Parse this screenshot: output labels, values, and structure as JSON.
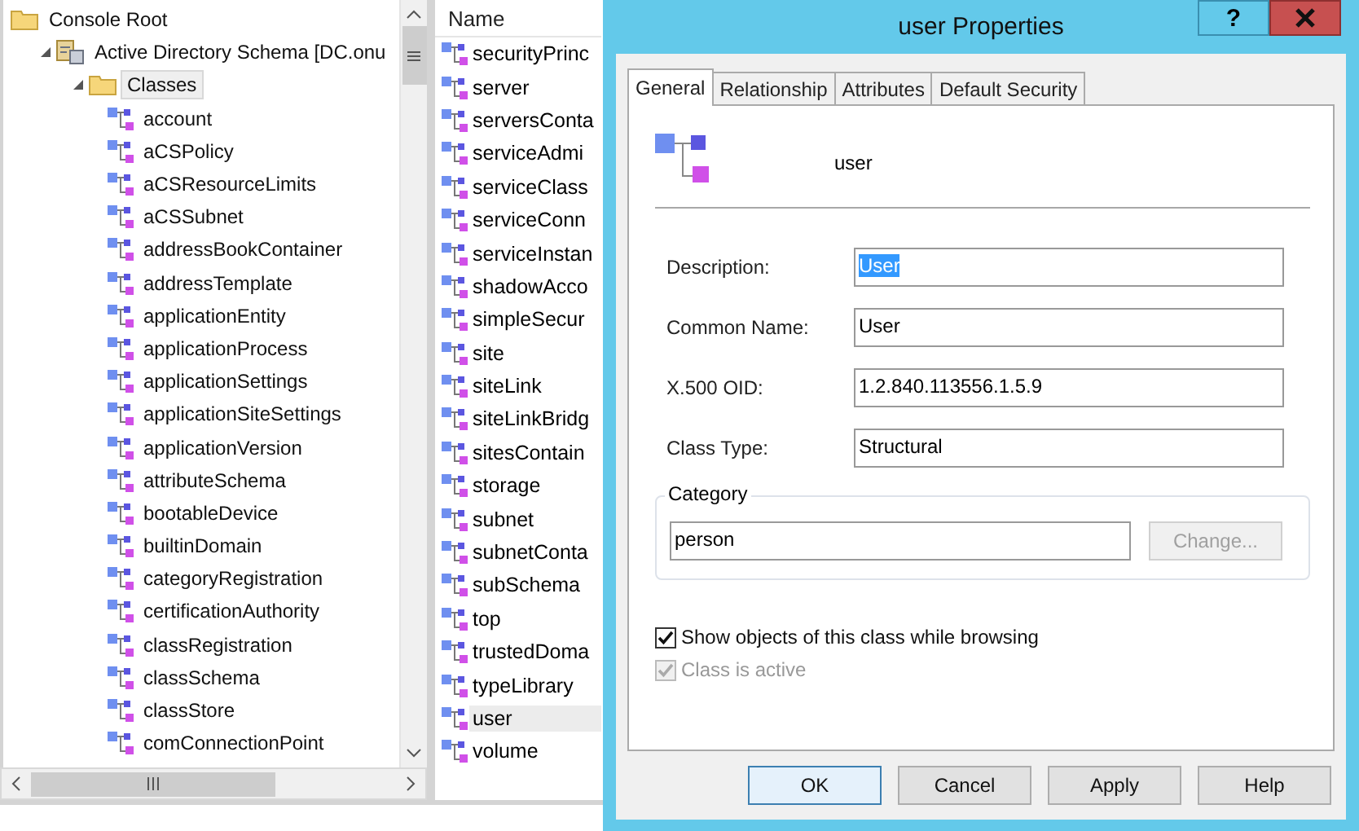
{
  "tree": [
    {
      "label": "Console Root",
      "kind": "root",
      "selected": false,
      "children": [
        {
          "label": "Active Directory Schema [DC.onu",
          "kind": "schema",
          "expanded": true,
          "selected": false,
          "children": [
            {
              "label": "Classes",
              "kind": "folder",
              "expanded": true,
              "selected": true,
              "children": [
                {
                  "label": "account",
                  "kind": "class",
                  "selected": false
                },
                {
                  "label": "aCSPolicy",
                  "kind": "class",
                  "selected": false
                },
                {
                  "label": "aCSResourceLimits",
                  "kind": "class",
                  "selected": false
                },
                {
                  "label": "aCSSubnet",
                  "kind": "class",
                  "selected": false
                },
                {
                  "label": "addressBookContainer",
                  "kind": "class",
                  "selected": false
                },
                {
                  "label": "addressTemplate",
                  "kind": "class",
                  "selected": false
                },
                {
                  "label": "applicationEntity",
                  "kind": "class",
                  "selected": false
                },
                {
                  "label": "applicationProcess",
                  "kind": "class",
                  "selected": false
                },
                {
                  "label": "applicationSettings",
                  "kind": "class",
                  "selected": false
                },
                {
                  "label": "applicationSiteSettings",
                  "kind": "class",
                  "selected": false
                },
                {
                  "label": "applicationVersion",
                  "kind": "class",
                  "selected": false
                },
                {
                  "label": "attributeSchema",
                  "kind": "class",
                  "selected": false
                },
                {
                  "label": "bootableDevice",
                  "kind": "class",
                  "selected": false
                },
                {
                  "label": "builtinDomain",
                  "kind": "class",
                  "selected": false
                },
                {
                  "label": "categoryRegistration",
                  "kind": "class",
                  "selected": false
                },
                {
                  "label": "certificationAuthority",
                  "kind": "class",
                  "selected": false
                },
                {
                  "label": "classRegistration",
                  "kind": "class",
                  "selected": false
                },
                {
                  "label": "classSchema",
                  "kind": "class",
                  "selected": false
                },
                {
                  "label": "classStore",
                  "kind": "class",
                  "selected": false
                },
                {
                  "label": "comConnectionPoint",
                  "kind": "class",
                  "selected": false
                }
              ]
            }
          ]
        }
      ]
    }
  ],
  "list": {
    "column": "Name",
    "rows": [
      {
        "label": "securityPrinc",
        "selected": false
      },
      {
        "label": "server",
        "selected": false
      },
      {
        "label": "serversConta",
        "selected": false
      },
      {
        "label": "serviceAdmi",
        "selected": false
      },
      {
        "label": "serviceClass",
        "selected": false
      },
      {
        "label": "serviceConn",
        "selected": false
      },
      {
        "label": "serviceInstan",
        "selected": false
      },
      {
        "label": "shadowAcco",
        "selected": false
      },
      {
        "label": "simpleSecur",
        "selected": false
      },
      {
        "label": "site",
        "selected": false
      },
      {
        "label": "siteLink",
        "selected": false
      },
      {
        "label": "siteLinkBridg",
        "selected": false
      },
      {
        "label": "sitesContain",
        "selected": false
      },
      {
        "label": "storage",
        "selected": false
      },
      {
        "label": "subnet",
        "selected": false
      },
      {
        "label": "subnetConta",
        "selected": false
      },
      {
        "label": "subSchema",
        "selected": false
      },
      {
        "label": "top",
        "selected": false
      },
      {
        "label": "trustedDoma",
        "selected": false
      },
      {
        "label": "typeLibrary",
        "selected": false
      },
      {
        "label": "user",
        "selected": true
      },
      {
        "label": "volume",
        "selected": false
      }
    ]
  },
  "dialog": {
    "title": "user Properties",
    "help": "?",
    "tabs": [
      {
        "label": "General",
        "selected": true
      },
      {
        "label": "Relationship",
        "selected": false
      },
      {
        "label": "Attributes",
        "selected": false
      },
      {
        "label": "Default Security",
        "selected": false
      }
    ],
    "class_name": "user",
    "fields": [
      {
        "label": "Description:",
        "value": "User",
        "highlighted": true
      },
      {
        "label": "Common Name:",
        "value": "User",
        "highlighted": false
      },
      {
        "label": "X.500 OID:",
        "value": "1.2.840.113556.1.5.9",
        "highlighted": false
      },
      {
        "label": "Class Type:",
        "value": "Structural",
        "highlighted": false
      }
    ],
    "category": {
      "label": "Category",
      "value": "person",
      "button": "Change...",
      "disabled": true
    },
    "checkboxes": [
      {
        "label": "Show objects of this class while browsing",
        "checked": true,
        "disabled": false
      },
      {
        "label": "Class is active",
        "checked": true,
        "disabled": true
      }
    ],
    "buttons": [
      {
        "label": "OK",
        "default": true
      },
      {
        "label": "Cancel",
        "default": false
      },
      {
        "label": "Apply",
        "default": false
      },
      {
        "label": "Help",
        "default": false
      }
    ]
  }
}
